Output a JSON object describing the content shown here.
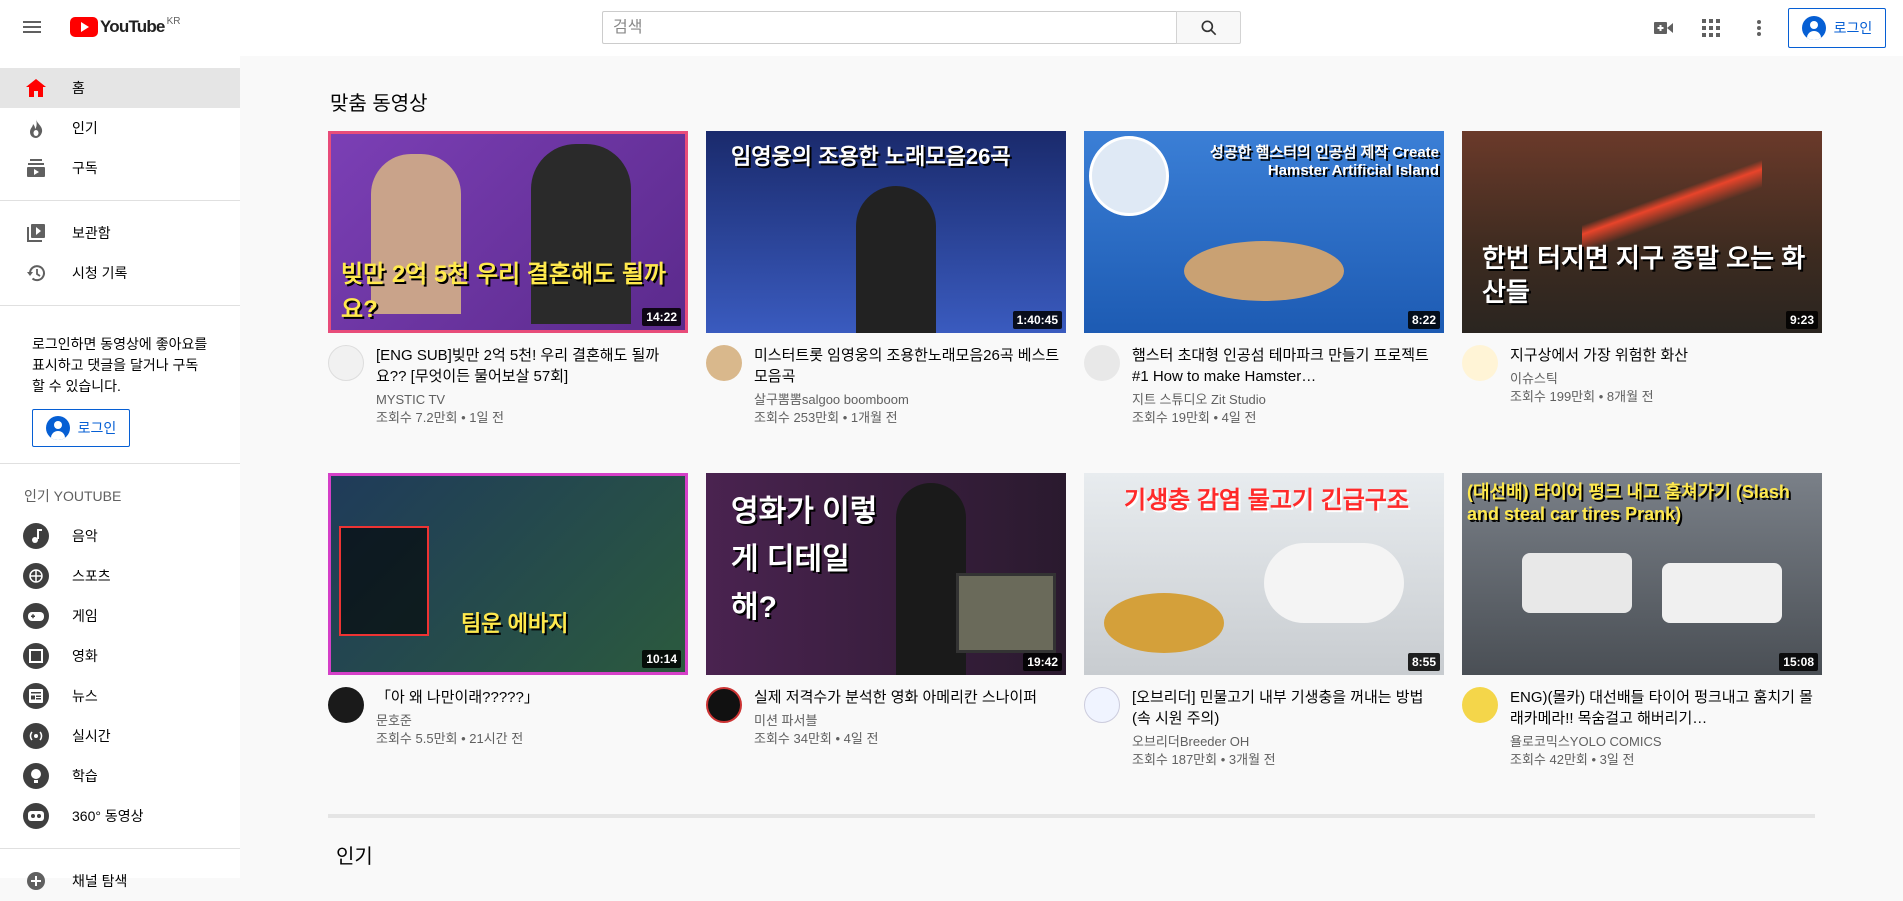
{
  "header": {
    "logo_text": "YouTube",
    "logo_region": "KR",
    "search_placeholder": "검색",
    "signin_label": "로그인"
  },
  "sidebar": {
    "main_items": [
      {
        "label": "홈",
        "icon": "home-icon",
        "active": true
      },
      {
        "label": "인기",
        "icon": "trending-icon"
      },
      {
        "label": "구독",
        "icon": "subscriptions-icon"
      }
    ],
    "library_items": [
      {
        "label": "보관함",
        "icon": "library-icon"
      },
      {
        "label": "시청 기록",
        "icon": "history-icon"
      }
    ],
    "signin_promo": "로그인하면 동영상에 좋아요를 표시하고 댓글을 달거나 구독할 수 있습니다.",
    "signin_label": "로그인",
    "popular_heading": "인기 YOUTUBE",
    "categories": [
      {
        "label": "음악",
        "icon": "music-icon"
      },
      {
        "label": "스포츠",
        "icon": "sports-icon"
      },
      {
        "label": "게임",
        "icon": "gaming-icon"
      },
      {
        "label": "영화",
        "icon": "movies-icon"
      },
      {
        "label": "뉴스",
        "icon": "news-icon"
      },
      {
        "label": "실시간",
        "icon": "live-icon"
      },
      {
        "label": "학습",
        "icon": "learning-icon"
      },
      {
        "label": "360° 동영상",
        "icon": "360-video-icon"
      }
    ],
    "browse_channels": "채널 탐색"
  },
  "main": {
    "section_title": "맞춤 동영상",
    "section_title_2": "인기",
    "videos": [
      {
        "title": "[ENG SUB]빚만 2억 5천! 우리 결혼해도 될까요?? [무엇이든 물어보살 57회]",
        "channel": "MYSTIC TV",
        "stats": "조회수 7.2만회 • 1일 전",
        "duration": "14:22",
        "thumb_text": "빚만 2억 5천 우리 결혼해도 될까요?"
      },
      {
        "title": "미스터트롯 임영웅의 조용한노래모음26곡 베스트 모음곡",
        "channel": "살구뽐뽐salgoo boomboom",
        "stats": "조회수 253만회 • 1개월 전",
        "duration": "1:40:45",
        "thumb_text": "임영웅의 조용한 노래모음26곡"
      },
      {
        "title": "햄스터 초대형 인공섬 테마파크 만들기 프로젝트 #1 How to make Hamster…",
        "channel": "지트 스튜디오 Zit Studio",
        "stats": "조회수 19만회 • 4일 전",
        "duration": "8:22",
        "thumb_text": "성공한 햄스터의 인공섬 제작 Create Hamster Artificial Island"
      },
      {
        "title": "지구상에서 가장 위험한 화산",
        "channel": "이슈스틱",
        "stats": "조회수 199만회 • 8개월 전",
        "duration": "9:23",
        "thumb_text": "한번 터지면 지구 종말 오는 화산들"
      },
      {
        "title": "「아 왜 나만이래?????」",
        "channel": "문호준",
        "stats": "조회수 5.5만회 • 21시간 전",
        "duration": "10:14",
        "thumb_text": "팀운 에바지"
      },
      {
        "title": "실제 저격수가 분석한 영화 아메리칸 스나이퍼",
        "channel": "미션 파서블",
        "stats": "조회수 34만회 • 4일 전",
        "duration": "19:42",
        "thumb_text": "영화가 이렇게 디테일해?"
      },
      {
        "title": "[오브리더] 민물고기 내부 기생충을 꺼내는 방법 (속 시원 주의)",
        "channel": "오브리더Breeder OH",
        "stats": "조회수 187만회 • 3개월 전",
        "duration": "8:55",
        "thumb_text": "기생충 감염 물고기 긴급구조"
      },
      {
        "title": "ENG)(몰카) 대선배들 타이어 펑크내고 훔치기 몰래카메라!! 목숨걸고 해버리기…",
        "channel": "욜로코믹스YOLO COMICS",
        "stats": "조회수 42만회 • 3일 전",
        "duration": "15:08",
        "thumb_text": "(대선배) 타이어 펑크 내고 훔쳐가기 (Slash and steal car tires Prank)"
      }
    ]
  },
  "colors": {
    "brand_red": "#ff0000",
    "link_blue": "#065fd4",
    "secondary_text": "#606060"
  }
}
